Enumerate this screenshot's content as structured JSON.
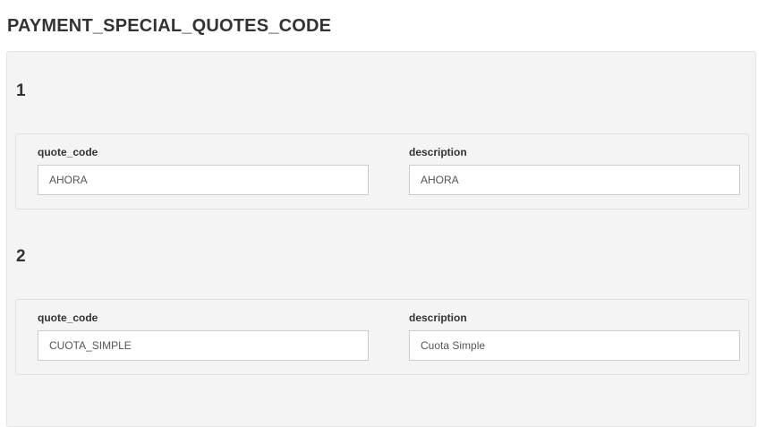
{
  "page": {
    "title": "PAYMENT_SPECIAL_QUOTES_CODE"
  },
  "items": [
    {
      "number": "1",
      "quote_code_label": "quote_code",
      "quote_code_value": "AHORA",
      "description_label": "description",
      "description_value": "AHORA"
    },
    {
      "number": "2",
      "quote_code_label": "quote_code",
      "quote_code_value": "CUOTA_SIMPLE",
      "description_label": "description",
      "description_value": "Cuota Simple"
    }
  ]
}
